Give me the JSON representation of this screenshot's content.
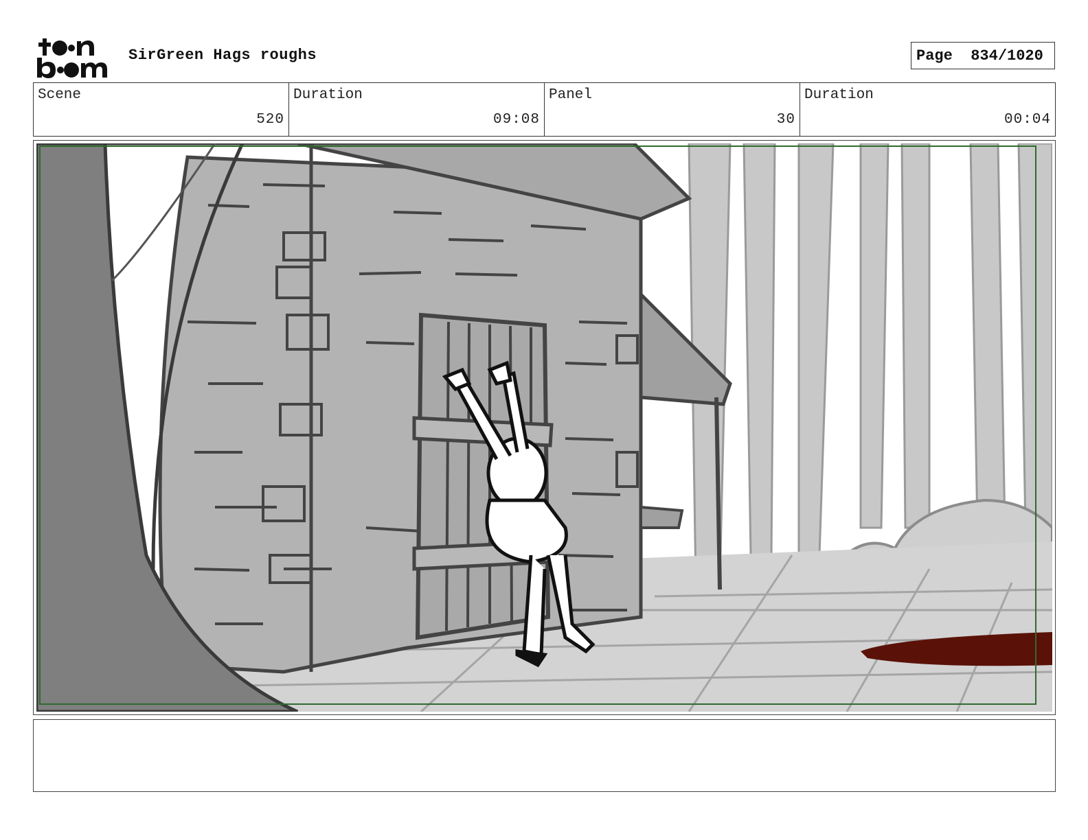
{
  "header": {
    "logo_text": "toon boom",
    "project_title": "SirGreen Hags roughs",
    "page_label": "Page",
    "page_number": "834/1020"
  },
  "info": {
    "scene_label": "Scene",
    "scene_value": "520",
    "scene_duration_label": "Duration",
    "scene_duration_value": "09:08",
    "panel_label": "Panel",
    "panel_value": "30",
    "panel_duration_label": "Duration",
    "panel_duration_value": "00:04"
  },
  "panel": {
    "safe_frame_color": "#2e6b2e",
    "blood_color": "#5a1208"
  },
  "notes": {
    "text": ""
  }
}
